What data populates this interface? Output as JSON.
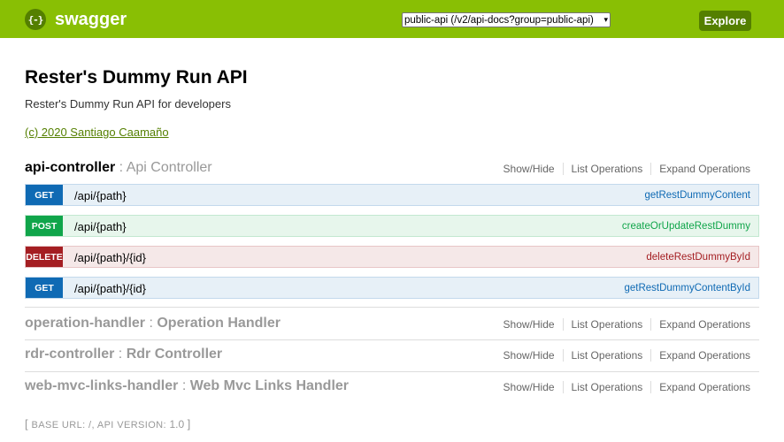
{
  "header": {
    "logo_symbol": "{-}",
    "logo_text": "swagger",
    "api_select_value": "public-api (/v2/api-docs?group=public-api)",
    "explore_label": "Explore",
    "bg_color": "#89bf04"
  },
  "info": {
    "title": "Rester's Dummy Run API",
    "description": "Rester's Dummy Run API for developers",
    "license": "(c) 2020 Santiago Caamaño"
  },
  "actions": {
    "show_hide": "Show/Hide",
    "list_operations": "List Operations",
    "expand_operations": "Expand Operations"
  },
  "resources": [
    {
      "name": "api-controller",
      "separator": " : ",
      "description": "Api Controller",
      "operations": [
        {
          "method": "GET",
          "path": "/api/{path}",
          "operation_id": "getRestDummyContent"
        },
        {
          "method": "POST",
          "path": "/api/{path}",
          "operation_id": "createOrUpdateRestDummy"
        },
        {
          "method": "DELETE",
          "path": "/api/{path}/{id}",
          "operation_id": "deleteRestDummyById"
        },
        {
          "method": "GET",
          "path": "/api/{path}/{id}",
          "operation_id": "getRestDummyContentById"
        }
      ]
    },
    {
      "name": "operation-handler",
      "separator": " : ",
      "description": "Operation Handler"
    },
    {
      "name": "rdr-controller",
      "separator": " : ",
      "description": "Rdr Controller"
    },
    {
      "name": "web-mvc-links-handler",
      "separator": " : ",
      "description": "Web Mvc Links Handler"
    }
  ],
  "footer": {
    "open_bracket": "[",
    "base_url_label": "BASE URL:",
    "base_url": "/",
    "comma": ",",
    "api_version_label": "API VERSION:",
    "api_version": "1.0",
    "close_bracket": "]"
  },
  "colors": {
    "get": "#0f6ab4",
    "post": "#10a54a",
    "delete": "#a41e22",
    "brand_dark": "#547f00"
  }
}
